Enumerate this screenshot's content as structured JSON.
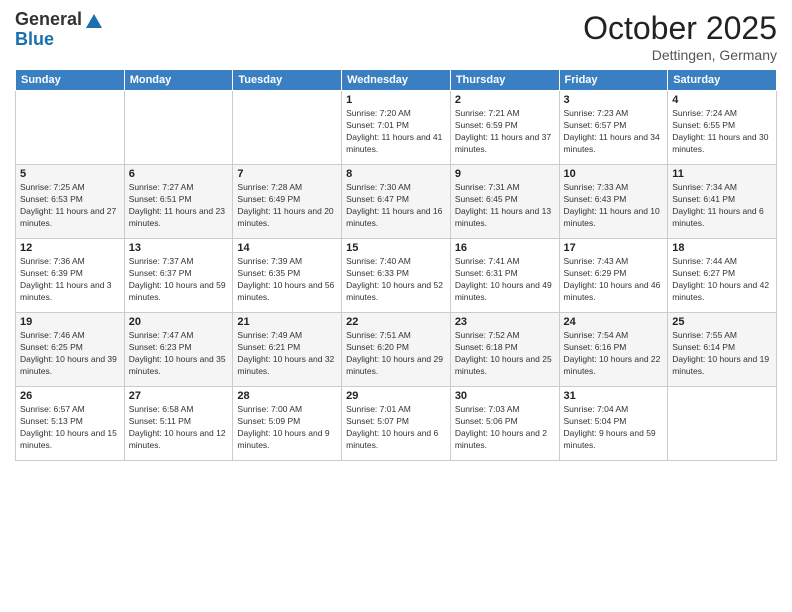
{
  "logo": {
    "general": "General",
    "blue": "Blue"
  },
  "header": {
    "month": "October 2025",
    "location": "Dettingen, Germany"
  },
  "weekdays": [
    "Sunday",
    "Monday",
    "Tuesday",
    "Wednesday",
    "Thursday",
    "Friday",
    "Saturday"
  ],
  "weeks": [
    [
      {
        "day": "",
        "info": ""
      },
      {
        "day": "",
        "info": ""
      },
      {
        "day": "",
        "info": ""
      },
      {
        "day": "1",
        "info": "Sunrise: 7:20 AM\nSunset: 7:01 PM\nDaylight: 11 hours and 41 minutes."
      },
      {
        "day": "2",
        "info": "Sunrise: 7:21 AM\nSunset: 6:59 PM\nDaylight: 11 hours and 37 minutes."
      },
      {
        "day": "3",
        "info": "Sunrise: 7:23 AM\nSunset: 6:57 PM\nDaylight: 11 hours and 34 minutes."
      },
      {
        "day": "4",
        "info": "Sunrise: 7:24 AM\nSunset: 6:55 PM\nDaylight: 11 hours and 30 minutes."
      }
    ],
    [
      {
        "day": "5",
        "info": "Sunrise: 7:25 AM\nSunset: 6:53 PM\nDaylight: 11 hours and 27 minutes."
      },
      {
        "day": "6",
        "info": "Sunrise: 7:27 AM\nSunset: 6:51 PM\nDaylight: 11 hours and 23 minutes."
      },
      {
        "day": "7",
        "info": "Sunrise: 7:28 AM\nSunset: 6:49 PM\nDaylight: 11 hours and 20 minutes."
      },
      {
        "day": "8",
        "info": "Sunrise: 7:30 AM\nSunset: 6:47 PM\nDaylight: 11 hours and 16 minutes."
      },
      {
        "day": "9",
        "info": "Sunrise: 7:31 AM\nSunset: 6:45 PM\nDaylight: 11 hours and 13 minutes."
      },
      {
        "day": "10",
        "info": "Sunrise: 7:33 AM\nSunset: 6:43 PM\nDaylight: 11 hours and 10 minutes."
      },
      {
        "day": "11",
        "info": "Sunrise: 7:34 AM\nSunset: 6:41 PM\nDaylight: 11 hours and 6 minutes."
      }
    ],
    [
      {
        "day": "12",
        "info": "Sunrise: 7:36 AM\nSunset: 6:39 PM\nDaylight: 11 hours and 3 minutes."
      },
      {
        "day": "13",
        "info": "Sunrise: 7:37 AM\nSunset: 6:37 PM\nDaylight: 10 hours and 59 minutes."
      },
      {
        "day": "14",
        "info": "Sunrise: 7:39 AM\nSunset: 6:35 PM\nDaylight: 10 hours and 56 minutes."
      },
      {
        "day": "15",
        "info": "Sunrise: 7:40 AM\nSunset: 6:33 PM\nDaylight: 10 hours and 52 minutes."
      },
      {
        "day": "16",
        "info": "Sunrise: 7:41 AM\nSunset: 6:31 PM\nDaylight: 10 hours and 49 minutes."
      },
      {
        "day": "17",
        "info": "Sunrise: 7:43 AM\nSunset: 6:29 PM\nDaylight: 10 hours and 46 minutes."
      },
      {
        "day": "18",
        "info": "Sunrise: 7:44 AM\nSunset: 6:27 PM\nDaylight: 10 hours and 42 minutes."
      }
    ],
    [
      {
        "day": "19",
        "info": "Sunrise: 7:46 AM\nSunset: 6:25 PM\nDaylight: 10 hours and 39 minutes."
      },
      {
        "day": "20",
        "info": "Sunrise: 7:47 AM\nSunset: 6:23 PM\nDaylight: 10 hours and 35 minutes."
      },
      {
        "day": "21",
        "info": "Sunrise: 7:49 AM\nSunset: 6:21 PM\nDaylight: 10 hours and 32 minutes."
      },
      {
        "day": "22",
        "info": "Sunrise: 7:51 AM\nSunset: 6:20 PM\nDaylight: 10 hours and 29 minutes."
      },
      {
        "day": "23",
        "info": "Sunrise: 7:52 AM\nSunset: 6:18 PM\nDaylight: 10 hours and 25 minutes."
      },
      {
        "day": "24",
        "info": "Sunrise: 7:54 AM\nSunset: 6:16 PM\nDaylight: 10 hours and 22 minutes."
      },
      {
        "day": "25",
        "info": "Sunrise: 7:55 AM\nSunset: 6:14 PM\nDaylight: 10 hours and 19 minutes."
      }
    ],
    [
      {
        "day": "26",
        "info": "Sunrise: 6:57 AM\nSunset: 5:13 PM\nDaylight: 10 hours and 15 minutes."
      },
      {
        "day": "27",
        "info": "Sunrise: 6:58 AM\nSunset: 5:11 PM\nDaylight: 10 hours and 12 minutes."
      },
      {
        "day": "28",
        "info": "Sunrise: 7:00 AM\nSunset: 5:09 PM\nDaylight: 10 hours and 9 minutes."
      },
      {
        "day": "29",
        "info": "Sunrise: 7:01 AM\nSunset: 5:07 PM\nDaylight: 10 hours and 6 minutes."
      },
      {
        "day": "30",
        "info": "Sunrise: 7:03 AM\nSunset: 5:06 PM\nDaylight: 10 hours and 2 minutes."
      },
      {
        "day": "31",
        "info": "Sunrise: 7:04 AM\nSunset: 5:04 PM\nDaylight: 9 hours and 59 minutes."
      },
      {
        "day": "",
        "info": ""
      }
    ]
  ]
}
